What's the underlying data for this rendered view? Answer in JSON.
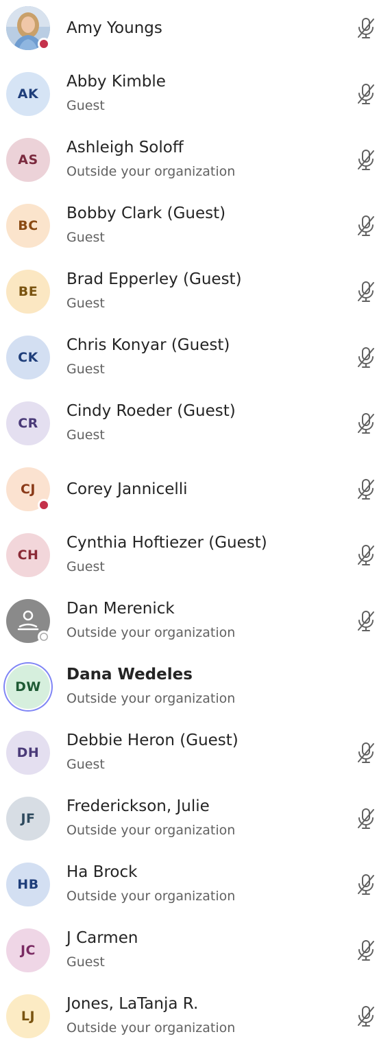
{
  "participants": [
    {
      "name": "Amy Youngs",
      "subtitle": "",
      "initials": "",
      "avatar_type": "photo",
      "avatar_bg": "#9bb6d6",
      "avatar_fg": "#ffffff",
      "presence": "busy",
      "muted": true,
      "bold": false
    },
    {
      "name": "Abby Kimble",
      "subtitle": "Guest",
      "initials": "AK",
      "avatar_type": "initials",
      "avatar_bg": "#d6e4f5",
      "avatar_fg": "#1f3e7a",
      "presence": "none",
      "muted": true,
      "bold": false
    },
    {
      "name": "Ashleigh Soloff",
      "subtitle": "Outside your organization",
      "initials": "AS",
      "avatar_type": "initials",
      "avatar_bg": "#ecd2d8",
      "avatar_fg": "#7a2a3e",
      "presence": "none",
      "muted": true,
      "bold": false
    },
    {
      "name": "Bobby Clark (Guest)",
      "subtitle": "Guest",
      "initials": "BC",
      "avatar_type": "initials",
      "avatar_bg": "#fbe4cc",
      "avatar_fg": "#8a4a12",
      "presence": "none",
      "muted": true,
      "bold": false
    },
    {
      "name": "Brad Epperley (Guest)",
      "subtitle": "Guest",
      "initials": "BE",
      "avatar_type": "initials",
      "avatar_bg": "#fbe7c2",
      "avatar_fg": "#7a5410",
      "presence": "none",
      "muted": true,
      "bold": false
    },
    {
      "name": "Chris Konyar (Guest)",
      "subtitle": "Guest",
      "initials": "CK",
      "avatar_type": "initials",
      "avatar_bg": "#d3dff2",
      "avatar_fg": "#1f3e7a",
      "presence": "none",
      "muted": true,
      "bold": false
    },
    {
      "name": "Cindy Roeder (Guest)",
      "subtitle": "Guest",
      "initials": "CR",
      "avatar_type": "initials",
      "avatar_bg": "#e4dff0",
      "avatar_fg": "#4a3a78",
      "presence": "none",
      "muted": true,
      "bold": false
    },
    {
      "name": "Corey Jannicelli",
      "subtitle": "",
      "initials": "CJ",
      "avatar_type": "initials",
      "avatar_bg": "#fbe2d0",
      "avatar_fg": "#8a3a18",
      "presence": "busy",
      "muted": true,
      "bold": false
    },
    {
      "name": "Cynthia Hoftiezer (Guest)",
      "subtitle": "Guest",
      "initials": "CH",
      "avatar_type": "initials",
      "avatar_bg": "#f2d6da",
      "avatar_fg": "#8a2a36",
      "presence": "none",
      "muted": true,
      "bold": false
    },
    {
      "name": "Dan Merenick",
      "subtitle": "Outside your organization",
      "initials": "",
      "avatar_type": "generic",
      "avatar_bg": "#8a8a8a",
      "avatar_fg": "#ffffff",
      "presence": "offline",
      "muted": true,
      "bold": false
    },
    {
      "name": "Dana Wedeles",
      "subtitle": "Outside your organization",
      "initials": "DW",
      "avatar_type": "initials",
      "avatar_bg": "#d6efdd",
      "avatar_fg": "#1e5a34",
      "presence": "none",
      "muted": false,
      "bold": true,
      "ring": true
    },
    {
      "name": "Debbie Heron (Guest)",
      "subtitle": "Guest",
      "initials": "DH",
      "avatar_type": "initials",
      "avatar_bg": "#e4dff0",
      "avatar_fg": "#4a3a78",
      "presence": "none",
      "muted": true,
      "bold": false
    },
    {
      "name": "Frederickson, Julie",
      "subtitle": "Outside your organization",
      "initials": "JF",
      "avatar_type": "initials",
      "avatar_bg": "#d7dde4",
      "avatar_fg": "#2e4a5e",
      "presence": "none",
      "muted": true,
      "bold": false
    },
    {
      "name": "Ha Brock",
      "subtitle": "Outside your organization",
      "initials": "HB",
      "avatar_type": "initials",
      "avatar_bg": "#d3dff2",
      "avatar_fg": "#1f3e7a",
      "presence": "none",
      "muted": true,
      "bold": false
    },
    {
      "name": "J Carmen",
      "subtitle": "Guest",
      "initials": "JC",
      "avatar_type": "initials",
      "avatar_bg": "#efd6e6",
      "avatar_fg": "#7a2a62",
      "presence": "none",
      "muted": true,
      "bold": false
    },
    {
      "name": "Jones, LaTanja R.",
      "subtitle": "Outside your organization",
      "initials": "LJ",
      "avatar_type": "initials",
      "avatar_bg": "#fcebc4",
      "avatar_fg": "#7a5410",
      "presence": "none",
      "muted": true,
      "bold": false
    }
  ],
  "icons": {
    "mic_muted": "mic-off-icon",
    "generic_avatar": "person-icon"
  },
  "colors": {
    "busy": "#c4314b",
    "mic": "#616161",
    "ring": "#7f85f5"
  }
}
